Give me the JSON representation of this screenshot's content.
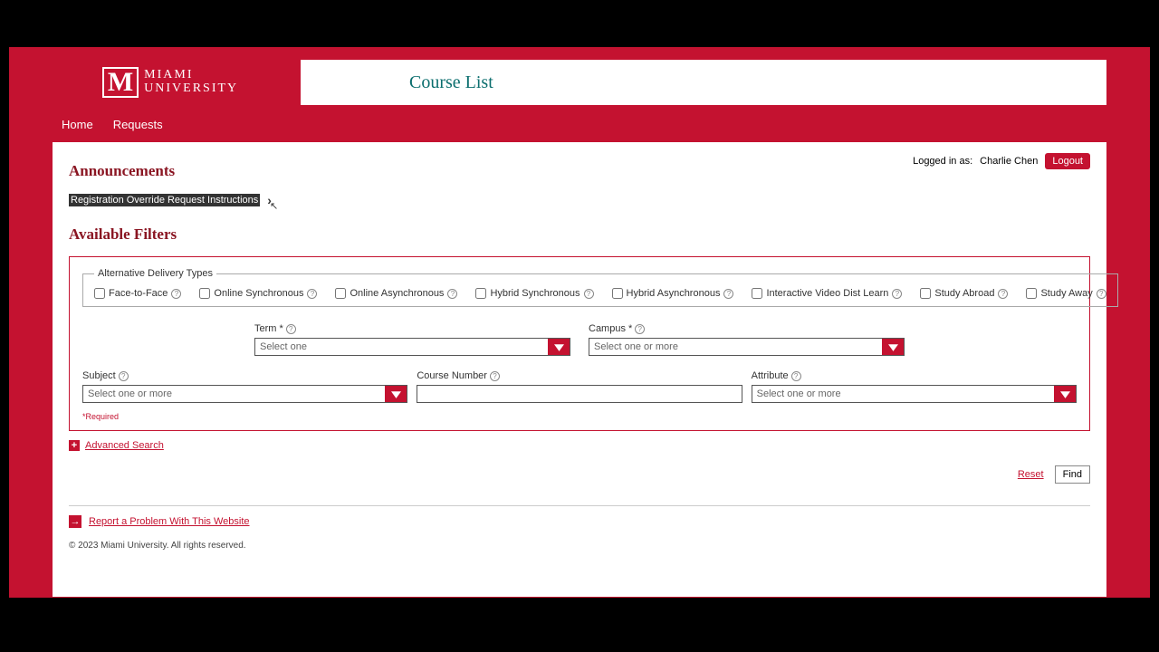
{
  "logo": {
    "line1": "MIAMI",
    "line2": "UNIVERSITY"
  },
  "page_title": "Course List",
  "nav": {
    "home": "Home",
    "requests": "Requests"
  },
  "user": {
    "prefix": "Logged in as: ",
    "name": "Charlie Chen",
    "logout": "Logout"
  },
  "sections": {
    "announcements": "Announcements",
    "available_filters": "Available Filters"
  },
  "announcement_link": "Registration Override Request Instructions",
  "adt_legend": "Alternative Delivery Types",
  "delivery_types": [
    "Face-to-Face",
    "Online Synchronous",
    "Online Asynchronous",
    "Hybrid Synchronous",
    "Hybrid Asynchronous",
    "Interactive Video Dist Learn",
    "Study Abroad",
    "Study Away"
  ],
  "fields": {
    "term": {
      "label": "Term",
      "placeholder": "Select one"
    },
    "campus": {
      "label": "Campus",
      "placeholder": "Select one or more"
    },
    "subject": {
      "label": "Subject",
      "placeholder": "Select one or more"
    },
    "course_number": {
      "label": "Course Number"
    },
    "attribute": {
      "label": "Attribute",
      "placeholder": "Select one or more"
    }
  },
  "required_note": "*Required",
  "advanced_search": "Advanced Search",
  "actions": {
    "reset": "Reset",
    "find": "Find"
  },
  "report_problem": "Report a Problem With This Website",
  "copyright": "© 2023 Miami University. All rights reserved."
}
